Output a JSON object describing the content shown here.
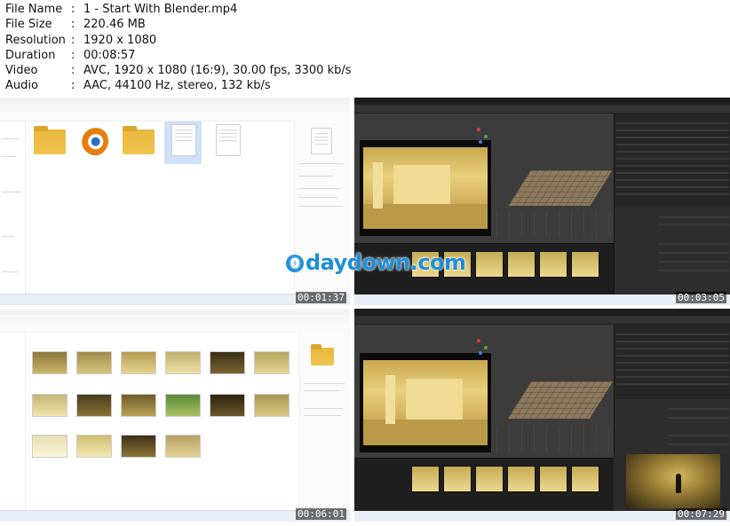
{
  "media_info": [
    {
      "label": "File Name",
      "value": "1 - Start With Blender.mp4"
    },
    {
      "label": "File Size",
      "value": "220.46 MB"
    },
    {
      "label": "Resolution",
      "value": "1920 x 1080"
    },
    {
      "label": "Duration",
      "value": "00:08:57"
    },
    {
      "label": "Video",
      "value": "AVC, 1920 x 1080 (16:9), 30.00 fps, 3300 kb/s"
    },
    {
      "label": "Audio",
      "value": "AAC, 44100 Hz, stereo, 132 kb/s"
    }
  ],
  "separator": ":",
  "thumbnails": [
    {
      "timestamp": "00:01:37",
      "content": "file-explorer-blender-files"
    },
    {
      "timestamp": "00:03:05",
      "content": "blender-scene-render"
    },
    {
      "timestamp": "00:06:01",
      "content": "file-explorer-image-gallery"
    },
    {
      "timestamp": "00:07:29",
      "content": "blender-scene-render-with-character"
    }
  ],
  "watermark": {
    "letter": "0",
    "text": "daydown.com",
    "color": "#1e8fd8"
  },
  "colors": {
    "blender_bg": "#2b2b2b",
    "folder": "#f1c44f",
    "room_wall": "#e8cf7d",
    "timestamp_text": "#ffffff"
  }
}
